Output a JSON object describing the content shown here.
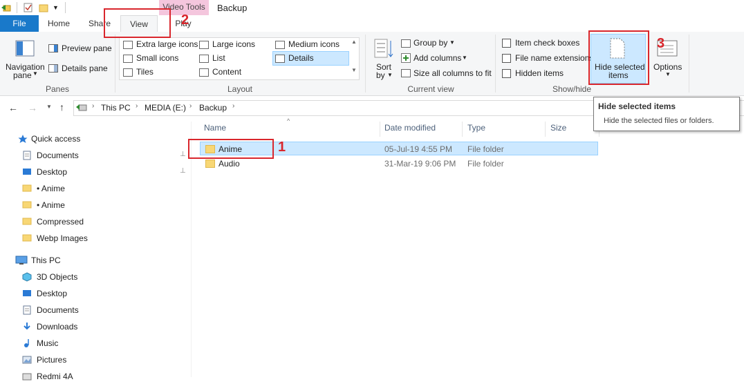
{
  "window": {
    "title": "Backup",
    "context_tab_header": "Video Tools"
  },
  "tabs": [
    {
      "label": "File"
    },
    {
      "label": "Home"
    },
    {
      "label": "Share"
    },
    {
      "label": "View"
    },
    {
      "label": "Play"
    }
  ],
  "ribbon": {
    "panes": {
      "label": "Panes",
      "navigation_pane": "Navigation",
      "navigation_pane_2": "pane",
      "preview_pane": "Preview pane",
      "details_pane": "Details pane"
    },
    "layout": {
      "label": "Layout",
      "options": [
        "Extra large icons",
        "Large icons",
        "Medium icons",
        "Small icons",
        "List",
        "Details",
        "Tiles",
        "Content"
      ],
      "selected": "Details"
    },
    "current_view": {
      "label": "Current view",
      "sort_by_1": "Sort",
      "sort_by_2": "by",
      "group_by": "Group by",
      "add_columns": "Add columns",
      "size_all_columns": "Size all columns to fit"
    },
    "show_hide": {
      "label": "Show/hide",
      "item_check_boxes": "Item check boxes",
      "file_name_extensions": "File name extensions",
      "hidden_items": "Hidden items",
      "hide_selected_1": "Hide selected",
      "hide_selected_2": "items"
    },
    "options": {
      "label": "Options"
    }
  },
  "address": {
    "breadcrumb": [
      "This PC",
      "MEDIA (E:)",
      "Backup"
    ]
  },
  "tooltip": {
    "title": "Hide selected items",
    "body": "Hide the selected files or folders."
  },
  "nav_pane": {
    "quick_access": "Quick access",
    "quick_items": [
      {
        "label": "Documents",
        "icon": "documents-icon",
        "pinned": true
      },
      {
        "label": "Desktop",
        "icon": "desktop-icon",
        "pinned": true
      },
      {
        "label": "• Anime",
        "icon": "folder-icon"
      },
      {
        "label": "• Anime",
        "icon": "folder-icon"
      },
      {
        "label": "Compressed",
        "icon": "folder-icon"
      },
      {
        "label": "Webp Images",
        "icon": "folder-icon"
      }
    ],
    "this_pc": "This PC",
    "pc_items": [
      {
        "label": "3D Objects",
        "icon": "cube-icon"
      },
      {
        "label": "Desktop",
        "icon": "desktop-icon"
      },
      {
        "label": "Documents",
        "icon": "documents-icon"
      },
      {
        "label": "Downloads",
        "icon": "download-icon"
      },
      {
        "label": "Music",
        "icon": "music-icon"
      },
      {
        "label": "Pictures",
        "icon": "pictures-icon"
      },
      {
        "label": "Redmi 4A",
        "icon": "phone-icon"
      }
    ]
  },
  "file_list": {
    "columns": [
      "Name",
      "Date modified",
      "Type",
      "Size"
    ],
    "rows": [
      {
        "name": "Anime",
        "date": "05-Jul-19 4:55 PM",
        "type": "File folder",
        "size": "",
        "selected": true
      },
      {
        "name": "Audio",
        "date": "31-Mar-19 9:06 PM",
        "type": "File folder",
        "size": "",
        "selected": false
      }
    ]
  },
  "annotations": {
    "step1": "1",
    "step2": "2",
    "step3": "3"
  },
  "colors": {
    "accent": "#1979ca",
    "selection": "#cce8ff",
    "annotation": "#d9262c",
    "context_tab": "#f4c6dd"
  }
}
